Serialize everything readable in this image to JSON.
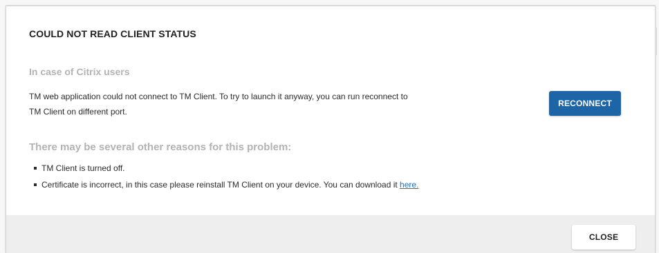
{
  "dialog": {
    "title": "COULD NOT READ CLIENT STATUS",
    "citrix_section": {
      "heading": "In case of Citrix users",
      "line1": "TM web application could not connect to TM Client. To try to launch it anyway, you can run reconnect to",
      "line2": "TM Client on different port.",
      "reconnect_label": "RECONNECT"
    },
    "reasons_section": {
      "heading": "There may be several other reasons for this problem:",
      "items": [
        {
          "text": "TM Client is turned off."
        },
        {
          "text": "Certificate is incorrect, in this case please reinstall TM Client on your device. You can download it ",
          "link": "here."
        }
      ]
    },
    "footer": {
      "close_label": "CLOSE"
    }
  },
  "colors": {
    "primary": "#1d65a6",
    "link": "#1e6eb5",
    "muted_heading": "#b3b3b3",
    "footer_bg": "#eeeeee"
  }
}
